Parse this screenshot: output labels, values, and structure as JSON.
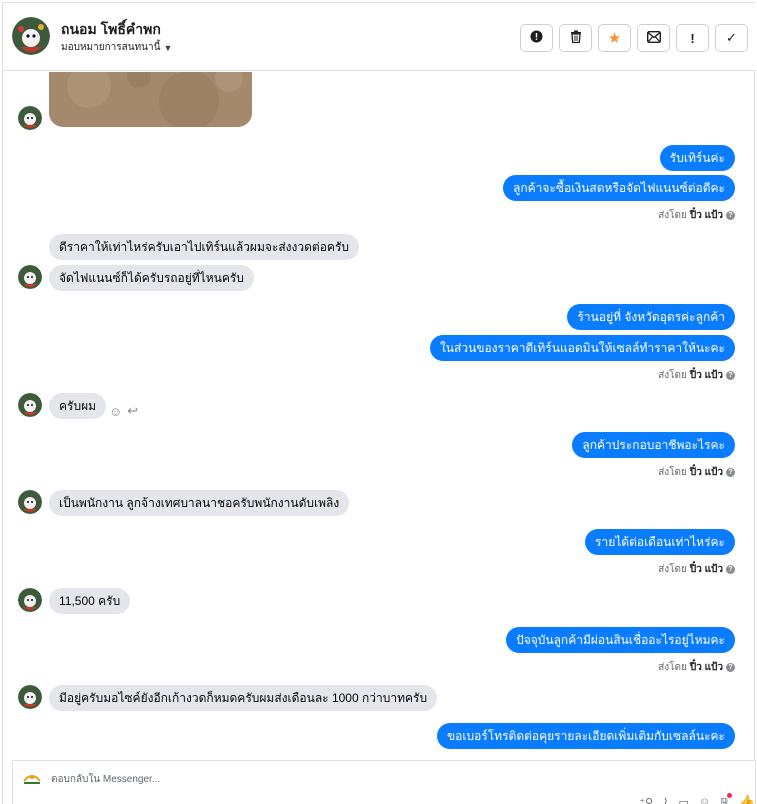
{
  "header": {
    "contact_name": "ถนอม โพธิ์คำพก",
    "assignment": "มอบหมายการสนทนานี้",
    "buttons": [
      {
        "icon": "alert-circle-icon",
        "glyph": "●"
      },
      {
        "icon": "trash-icon",
        "glyph": "🗑"
      },
      {
        "icon": "star-icon",
        "glyph": "★"
      },
      {
        "icon": "mail-icon",
        "glyph": "✉"
      },
      {
        "icon": "exclamation-icon",
        "glyph": "!"
      },
      {
        "icon": "check-icon",
        "glyph": "✓"
      }
    ]
  },
  "messages": [
    {
      "dir": "out",
      "text": "รับเทิร์นค่ะ"
    },
    {
      "dir": "out",
      "text": "ลูกค้าจะซื้อเงินสดหรือจัดไฟแนนซ์ต่อดีคะ"
    },
    {
      "dir": "sent",
      "label": "ส่งโดย",
      "sender": "ปิ๋ว แป้ว"
    },
    {
      "dir": "in",
      "text": "ดีราคาให้เท่าไหร่ครับเอาไปเทิร์นแล้วผมจะส่งงวดต่อครับ"
    },
    {
      "dir": "in",
      "text": "จัดไฟแนนซ์ก็ได้ครับรถอยู่ที่ไหนครับ"
    },
    {
      "dir": "out",
      "text": "ร้านอยู่ที่ จังหวัดอุดรค่ะลูกค้า"
    },
    {
      "dir": "out",
      "text": "ในส่วนของราคาดีเทิร์นแอดมินให้เซลล์ทำราคาให้นะคะ"
    },
    {
      "dir": "sent",
      "label": "ส่งโดย",
      "sender": "ปิ๋ว แป้ว"
    },
    {
      "dir": "in",
      "text": "ครับผม"
    },
    {
      "dir": "out",
      "text": "ลูกค้าประกอบอาชีพอะไรคะ"
    },
    {
      "dir": "sent",
      "label": "ส่งโดย",
      "sender": "ปิ๋ว แป้ว"
    },
    {
      "dir": "in",
      "text": "เป็นพนักงาน ลูกจ้างเทศบาลนาชอครับพนักงานดับเพลิง"
    },
    {
      "dir": "out",
      "text": "รายได้ต่อเดือนเท่าไหร่คะ"
    },
    {
      "dir": "sent",
      "label": "ส่งโดย",
      "sender": "ปิ๋ว แป้ว"
    },
    {
      "dir": "in",
      "text": "11,500 ครับ"
    },
    {
      "dir": "out",
      "text": "ปัจจุบันลูกค้ามีผ่อนสินเชื่ออะไรอยู่ไหมคะ"
    },
    {
      "dir": "sent",
      "label": "ส่งโดย",
      "sender": "ปิ๋ว แป้ว"
    },
    {
      "dir": "in",
      "text": "มีอยู่ครับมอไซค์ยังอีกเก้างวดก็หมดครับผมส่งเดือนละ 1000 กว่าบาทครับ"
    },
    {
      "dir": "out",
      "text": "ขอเบอร์โทรติดต่อคุยรายละเอียดเพิ่มเติมกับเซลล์นะคะ"
    }
  ],
  "reactions": {
    "emoji_icon": "smiley-icon",
    "reply_icon": "reply-icon"
  },
  "composer": {
    "placeholder": "ตอบกลับใน Messenger...",
    "icons": [
      "add-person-icon",
      "attachment-icon",
      "saved-replies-icon",
      "emoji-icon",
      "ad-icon",
      "thumbs-up-icon"
    ]
  },
  "colors": {
    "outgoing": "#0a7cff",
    "incoming": "#e4e6eb",
    "accent_star": "#f7923a"
  }
}
